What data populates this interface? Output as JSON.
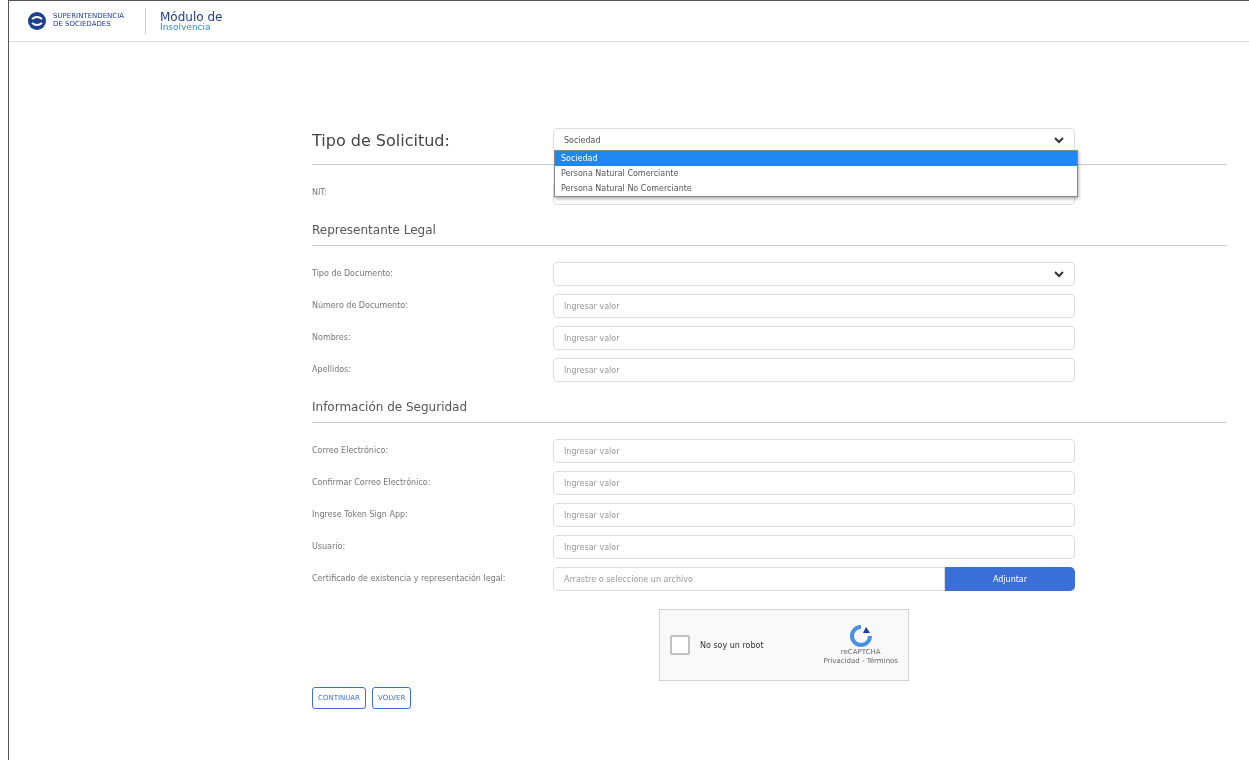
{
  "header": {
    "org_name": "SUPERINTENDENCIA DE SOCIEDADES",
    "module_line1": "Módulo de",
    "module_line2": "Insolvencia"
  },
  "request_type": {
    "label": "Tipo de Solicitud:",
    "value": "Sociedad",
    "expanded": true,
    "options": [
      {
        "label": "Sociedad",
        "selected": true
      },
      {
        "label": "Persona Natural Comerciante",
        "selected": false
      },
      {
        "label": "Persona Natural No Comerciante",
        "selected": false
      }
    ]
  },
  "nit": {
    "label": "NIT:"
  },
  "sections": [
    {
      "title": "Representante Legal",
      "fields": [
        {
          "kind": "select",
          "label": "Tipo de Documento:"
        },
        {
          "kind": "text",
          "label": "Número de Documento:",
          "placeholder": "Ingresar valor"
        },
        {
          "kind": "text",
          "label": "Nombres:",
          "placeholder": "Ingresar valor"
        },
        {
          "kind": "text",
          "label": "Apellidos:",
          "placeholder": "Ingresar valor"
        }
      ]
    },
    {
      "title": "Información de Seguridad",
      "fields": [
        {
          "kind": "text",
          "label": "Correo Electrónico:",
          "placeholder": "Ingresar valor"
        },
        {
          "kind": "text",
          "label": "Confirmar Correo Electrónico:",
          "placeholder": "Ingresar valor"
        },
        {
          "kind": "text",
          "label": "Ingrese Token Sign App:",
          "placeholder": "Ingresar valor"
        },
        {
          "kind": "text",
          "label": "Usuario:",
          "placeholder": "Ingresar valor"
        },
        {
          "kind": "file",
          "label": "Certificado de existencia y representación legal:",
          "placeholder": "Arrastre o seleccione un archivo",
          "button": "Adjuntar"
        }
      ]
    }
  ],
  "captcha": {
    "label": "No soy un robot",
    "checked": false,
    "brand": "reCAPTCHA",
    "links": "Privacidad - Términos"
  },
  "buttons": [
    "CONTINUAR",
    "VOLVER"
  ]
}
